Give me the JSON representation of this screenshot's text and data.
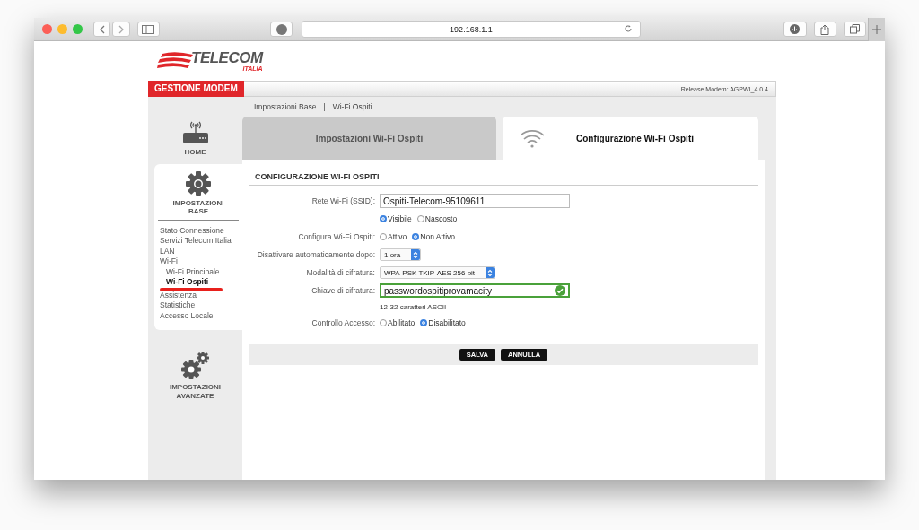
{
  "browser": {
    "address": "192.168.1.1"
  },
  "logo": {
    "name": "TELECOM",
    "sub": "ITALIA"
  },
  "header": {
    "title": "GESTIONE MODEM",
    "release": "Release Modem: AGPWI_4.0.4"
  },
  "sidebar": {
    "sections": [
      {
        "kind": "home",
        "label": "HOME",
        "selected": false
      },
      {
        "kind": "base",
        "label": "IMPOSTAZIONI BASE",
        "selected": true,
        "items": [
          {
            "label": "Stato Connessione",
            "selected": false,
            "underlined": false
          },
          {
            "label": "Servizi Telecom Italia",
            "selected": false,
            "underlined": false
          },
          {
            "label": "LAN",
            "selected": false,
            "underlined": false
          },
          {
            "label": "Wi-Fi",
            "selected": false,
            "underlined": false,
            "children": [
              {
                "label": "Wi-Fi Principale",
                "selected": false,
                "underlined": false
              },
              {
                "label": "Wi-Fi Ospiti",
                "selected": true,
                "underlined": true
              }
            ]
          },
          {
            "label": "Assistenza",
            "selected": false,
            "underlined": false
          },
          {
            "label": "Statistiche",
            "selected": false,
            "underlined": false
          },
          {
            "label": "Accesso Locale",
            "selected": false,
            "underlined": false
          }
        ]
      },
      {
        "kind": "advanced",
        "label": "IMPOSTAZIONI AVANZATE",
        "selected": false
      }
    ]
  },
  "breadcrumb": {
    "items": [
      "Impostazioni Base",
      "Wi-Fi Ospiti"
    ],
    "separator": "|"
  },
  "tabs": [
    {
      "label": "Impostazioni Wi-Fi Ospiti",
      "selected": false,
      "kind": "plain"
    },
    {
      "label": "Configurazione Wi-Fi Ospiti",
      "selected": true,
      "kind": "wifi"
    }
  ],
  "form": {
    "title": "CONFIGURAZIONE WI-FI OSPITI",
    "rows": [
      {
        "kind": "text",
        "label": "Rete Wi-Fi (SSID):",
        "value": "Ospiti-Telecom-95109611",
        "valid": false
      },
      {
        "kind": "radio",
        "options": [
          {
            "label": "Visibile",
            "selected": true
          },
          {
            "label": "Nascosto",
            "selected": false
          }
        ]
      },
      {
        "kind": "radio",
        "label": "Configura Wi-Fi Ospiti:",
        "options": [
          {
            "label": "Attivo",
            "selected": false
          },
          {
            "label": "Non Attivo",
            "selected": true
          }
        ]
      },
      {
        "kind": "select",
        "label": "Disattivare automaticamente dopo:",
        "value": "1 ora"
      },
      {
        "kind": "select",
        "label": "Modalità di cifratura:",
        "value": "WPA-PSK TKIP-AES 256 bit"
      },
      {
        "kind": "text",
        "label": "Chiave di cifratura:",
        "value": "passwordospitiprovamacity",
        "valid": true
      },
      {
        "kind": "hint",
        "text": "12-32 caratteri ASCII"
      },
      {
        "kind": "radio",
        "label": "Controllo Accesso:",
        "options": [
          {
            "label": "Abilitato",
            "selected": false
          },
          {
            "label": "Disabilitato",
            "selected": true
          }
        ]
      }
    ],
    "buttons": [
      "SALVA",
      "ANNULLA"
    ]
  }
}
